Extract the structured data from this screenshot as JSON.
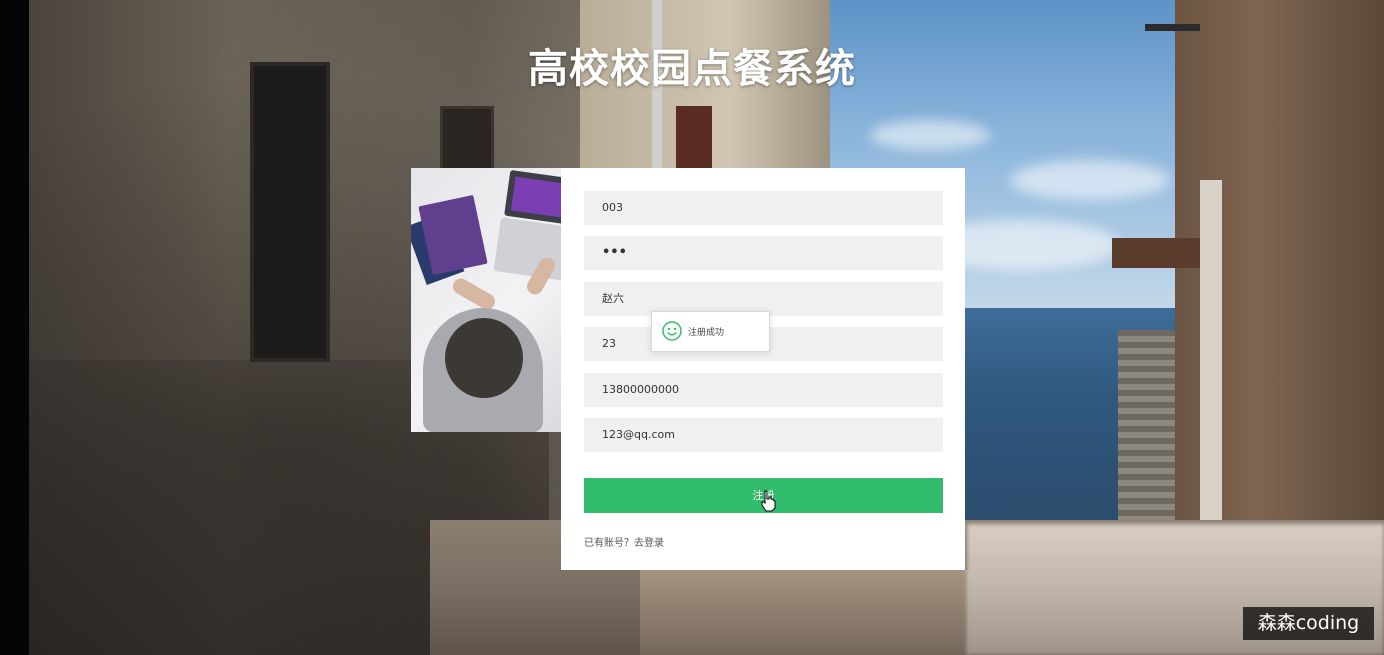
{
  "app": {
    "title": "高校校园点餐系统"
  },
  "form": {
    "fields": [
      {
        "name": "account",
        "value": "003"
      },
      {
        "name": "password",
        "value": "•••"
      },
      {
        "name": "real-name",
        "value": "赵六"
      },
      {
        "name": "age",
        "value": "23"
      },
      {
        "name": "phone",
        "value": "13800000000"
      },
      {
        "name": "email",
        "value": "123@qq.com"
      }
    ],
    "submit_label": "注册",
    "login_link": "已有账号？去登录"
  },
  "toast": {
    "message": "注册成功",
    "icon": "smile-icon"
  },
  "watermark": {
    "text": "森森coding"
  },
  "colors": {
    "accent": "#31bd6d",
    "card": "#ffffff",
    "field": "#f0f0f0"
  }
}
